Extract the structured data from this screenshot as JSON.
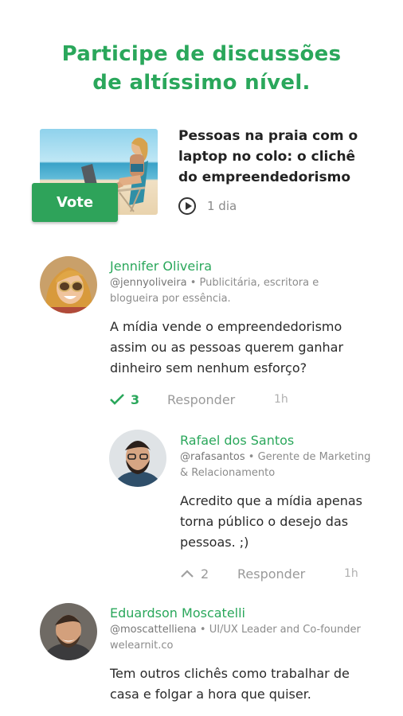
{
  "headline": {
    "line1": "Participe de discussões",
    "line2": "de altíssimo nível."
  },
  "featured": {
    "title": "Pessoas na praia com o laptop no colo: o clichê do empreendedorismo",
    "vote_label": "Vote",
    "age": "1 dia",
    "play_icon": "play-circle-icon"
  },
  "comments": [
    {
      "name": "Jennifer Oliveira",
      "handle": "@jennyoliveira",
      "bio": "• Publicitária, escritora e blogueira por essência.",
      "body": "A mídia vende o empreendedorismo assim ou as pessoas querem ganhar dinheiro sem nenhum esforço?",
      "votes": "3",
      "reply_label": "Responder",
      "time": "1h"
    },
    {
      "name": "Rafael dos Santos",
      "handle": "@rafasantos",
      "bio": "• Gerente de Marketing & Relacionamento",
      "body": "Acredito que a mídia apenas torna público o desejo das pessoas. ;)",
      "votes": "2",
      "reply_label": "Responder",
      "time": "1h"
    },
    {
      "name": "Eduardson Moscatelli",
      "handle": "@moscattelliena",
      "bio": "• UI/UX Leader and Co-founder welearnit.co",
      "body": "Tem outros clichês como trabalhar de casa e folgar a hora que quiser."
    }
  ],
  "colors": {
    "accent": "#2aa75b",
    "vote_button": "#2ea35a",
    "muted_text": "#8c8c8c"
  }
}
